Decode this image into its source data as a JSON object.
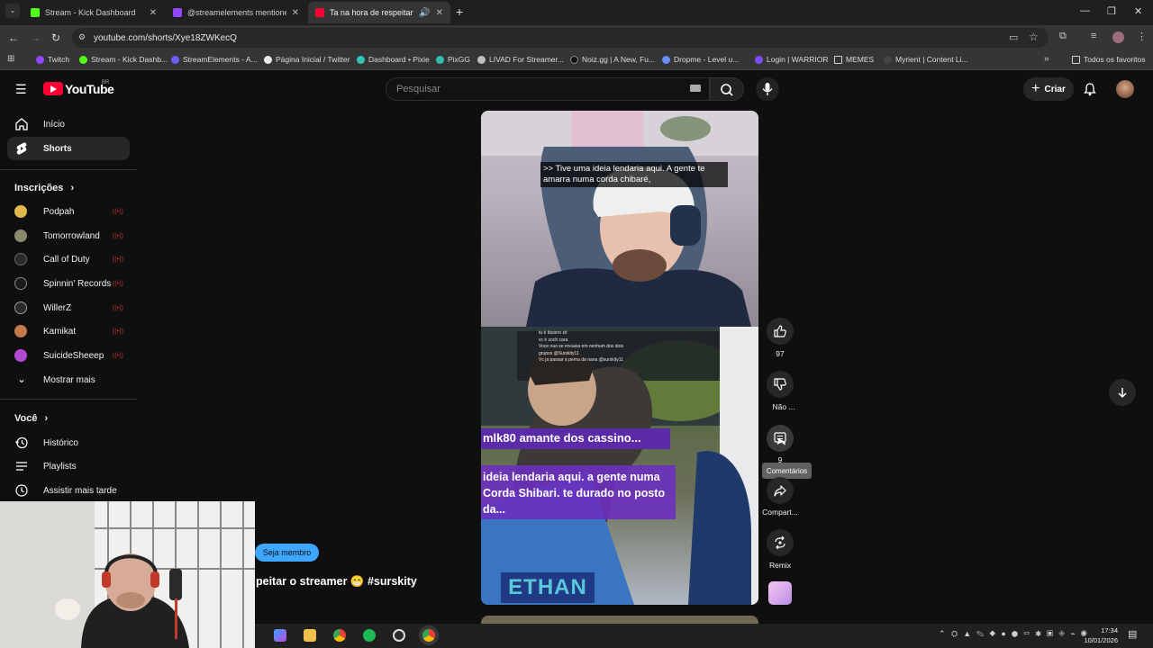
{
  "browser": {
    "tabs": [
      {
        "title": "Stream - Kick Dashboard",
        "icon": "kick-icon",
        "color": "#53fc18",
        "active": false
      },
      {
        "title": "@streamelements mentione",
        "icon": "twitch-icon",
        "color": "#9146ff",
        "active": false
      },
      {
        "title": "Ta na hora de respeitar o st",
        "icon": "youtube-icon",
        "color": "#ff0033",
        "active": true
      }
    ],
    "new_tab": "+",
    "url": "youtube.com/shorts/Xye18ZWKecQ",
    "bookmarks": [
      {
        "label": "Twitch",
        "color": "#9146ff"
      },
      {
        "label": "Stream - Kick Dashb...",
        "color": "#53fc18"
      },
      {
        "label": "StreamElements - A...",
        "color": "#6a5cff"
      },
      {
        "label": "Página Inicial / Twitter",
        "color": "#e7e7e7"
      },
      {
        "label": "Dashboard • Pixie",
        "color": "#2ec4b6"
      },
      {
        "label": "PixGG",
        "color": "#32bcad"
      },
      {
        "label": "LIVAD For Streamer...",
        "color": "#bdbdbd"
      },
      {
        "label": "Noiz.gg | A New, Fu...",
        "color": "#111111"
      },
      {
        "label": "Dropme - Level u...",
        "color": "#6c8cff"
      },
      {
        "label": "Login | WARRIOR",
        "color": "#7c4dff"
      },
      {
        "label": "MEMES",
        "color": "#cccccc"
      },
      {
        "label": "Myrient | Content Li...",
        "color": "#444444"
      }
    ],
    "all_bookmarks": "Todos os favoritos"
  },
  "header": {
    "logo_text": "YouTube",
    "region": "BR",
    "search_placeholder": "Pesquisar",
    "create_label": "Criar"
  },
  "sidebar": {
    "main": [
      {
        "label": "Início",
        "icon": "home-icon"
      },
      {
        "label": "Shorts",
        "icon": "shorts-icon",
        "active": true
      }
    ],
    "subs_title": "Inscrições",
    "subs": [
      {
        "label": "Podpah",
        "color": "#e0b84a"
      },
      {
        "label": "Tomorrowland",
        "color": "#8a8a6e"
      },
      {
        "label": "Call of Duty",
        "color": "#2b2b2b"
      },
      {
        "label": "Spinnin' Records",
        "color": "#1a1a1a"
      },
      {
        "label": "WillerZ",
        "color": "#2a2a2a"
      },
      {
        "label": "Kamikat",
        "color": "#c47a4a"
      },
      {
        "label": "SuicideSheeep",
        "color": "#b24ad1"
      }
    ],
    "show_more": "Mostrar mais",
    "you_title": "Você",
    "you": [
      {
        "label": "Histórico",
        "icon": "history-icon"
      },
      {
        "label": "Playlists",
        "icon": "playlists-icon"
      },
      {
        "label": "Assistir mais tarde",
        "icon": "watch-later-icon"
      }
    ]
  },
  "short": {
    "caption": ">> Tive uma ideia lendaria aqui. A gente te amarra numa corda chibaré,",
    "overlay_line1": "mlk80 amante dos cassino...",
    "overlay_line2": "ideia lendaria aqui. a gente numa Corda Shibari. te durado no posto da...",
    "player_name": "ETHAN",
    "chat_lines": [
      "tu é bizarro zé",
      "vc é zoch cara",
      "Voce nao se encaixa em nenhum dos dois",
      "grupos @Surskity11",
      "Vc ja passar a perna da nana @surskity11"
    ],
    "title": "peitar o streamer 😁 #surskity",
    "member_button": "Seja membro"
  },
  "actions": {
    "like_count": "97",
    "dislike_label": "Não ...",
    "comments_count": "9",
    "comments_tooltip": "Comentários",
    "share_label": "Compart...",
    "remix_label": "Remix"
  },
  "taskbar": {
    "time": "17:34",
    "date": "10/01/2026"
  }
}
